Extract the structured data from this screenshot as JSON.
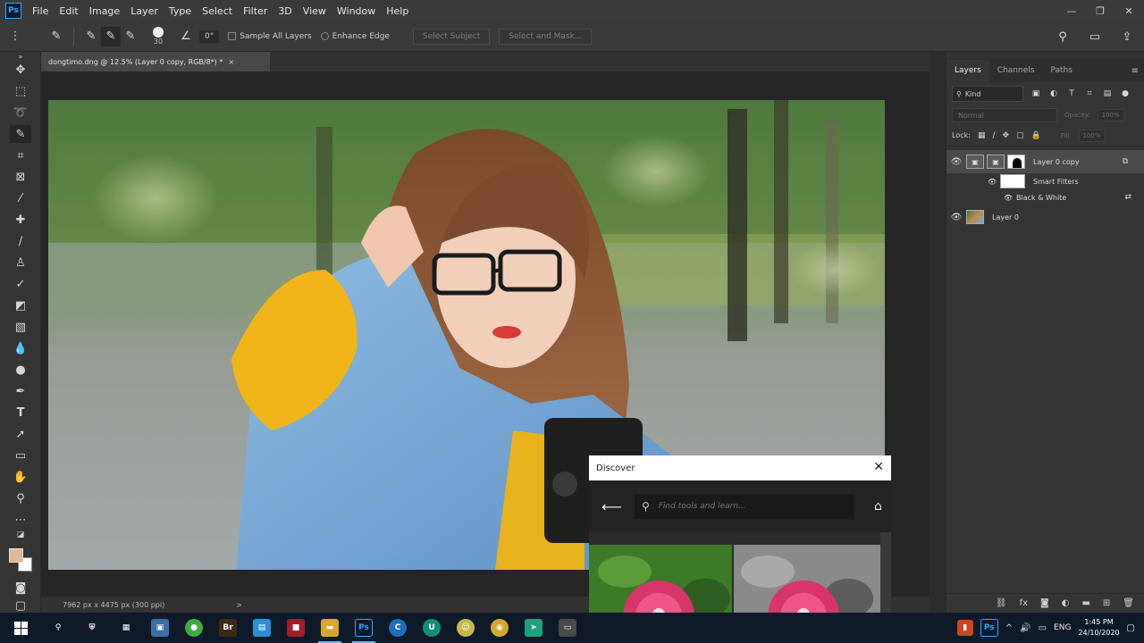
{
  "app": {
    "logo_text": "Ps",
    "menu": [
      "File",
      "Edit",
      "Image",
      "Layer",
      "Type",
      "Select",
      "Filter",
      "3D",
      "View",
      "Window",
      "Help"
    ],
    "window_controls": [
      "—",
      "❐",
      "✕"
    ]
  },
  "options_bar": {
    "brush_size": "30",
    "angle": "0°",
    "sample_all_layers": "Sample All Layers",
    "enhance_edge": "Enhance Edge",
    "select_subject": "Select Subject",
    "select_and_mask": "Select and Mask..."
  },
  "document": {
    "tab_title": "dongtimo.dng @ 12.5% (Layer 0 copy, RGB/8*) *",
    "close": "×",
    "status": "7962 px x 4475 px (300 ppi)",
    "status_arrow": ">"
  },
  "layers_panel": {
    "tabs": [
      "Layers",
      "Channels",
      "Paths"
    ],
    "menu_icon": "≡",
    "filter_kind": "Kind",
    "blend_mode": "Normal",
    "opacity_label": "Opacity:",
    "opacity_value": "100%",
    "lock_label": "Lock:",
    "fill_label": "Fill:",
    "fill_value": "100%",
    "layers": [
      {
        "name": "Layer 0 copy",
        "visible": true,
        "selected": true
      },
      {
        "name": "Layer 0",
        "visible": true,
        "selected": false
      }
    ],
    "smart_filters_label": "Smart Filters",
    "black_white_label": "Black & White",
    "bottom_icons": [
      "link-icon",
      "fx-icon",
      "mask-icon",
      "adjustment-icon",
      "group-icon",
      "new-layer-icon",
      "trash-icon"
    ],
    "fx_text": "fx"
  },
  "discover": {
    "title": "Discover",
    "close": "✕",
    "search_placeholder": "Find tools and learn..."
  },
  "taskbar": {
    "time": "1:45 PM",
    "date": "24/10/2020",
    "language": "ENG",
    "apps": [
      {
        "name": "search",
        "glyph": "⚲",
        "color": "#0e1a2a"
      },
      {
        "name": "security",
        "glyph": "⛨",
        "color": "#0e1a2a"
      },
      {
        "name": "store",
        "glyph": "▦",
        "color": "#0e1a2a"
      },
      {
        "name": "photos",
        "glyph": "▣",
        "color": "#3b6ea5"
      },
      {
        "name": "green-app",
        "glyph": "●",
        "color": "#3faa3f"
      },
      {
        "name": "bridge",
        "glyph": "Br",
        "color": "#3d2a14"
      },
      {
        "name": "calendar",
        "glyph": "▤",
        "color": "#2b8fd6"
      },
      {
        "name": "media",
        "glyph": "■",
        "color": "#a31e2a"
      },
      {
        "name": "explorer",
        "glyph": "▬",
        "color": "#d9a72c"
      },
      {
        "name": "photoshop",
        "glyph": "Ps",
        "color": "#0a1a2c"
      },
      {
        "name": "circle-c",
        "glyph": "C",
        "color": "#1d6fb8"
      },
      {
        "name": "circle-u",
        "glyph": "U",
        "color": "#138e7a"
      },
      {
        "name": "emoji",
        "glyph": "☺",
        "color": "#c8b84a"
      },
      {
        "name": "chrome",
        "glyph": "◉",
        "color": "#d7a72a"
      },
      {
        "name": "arrow-app",
        "glyph": "➤",
        "color": "#1aa17d"
      },
      {
        "name": "camera",
        "glyph": "▭",
        "color": "#4a4a4a"
      }
    ]
  },
  "colors": {
    "accent": "#31a8ff",
    "foreground_color": "#e0b898",
    "background_color": "#ffffff"
  }
}
